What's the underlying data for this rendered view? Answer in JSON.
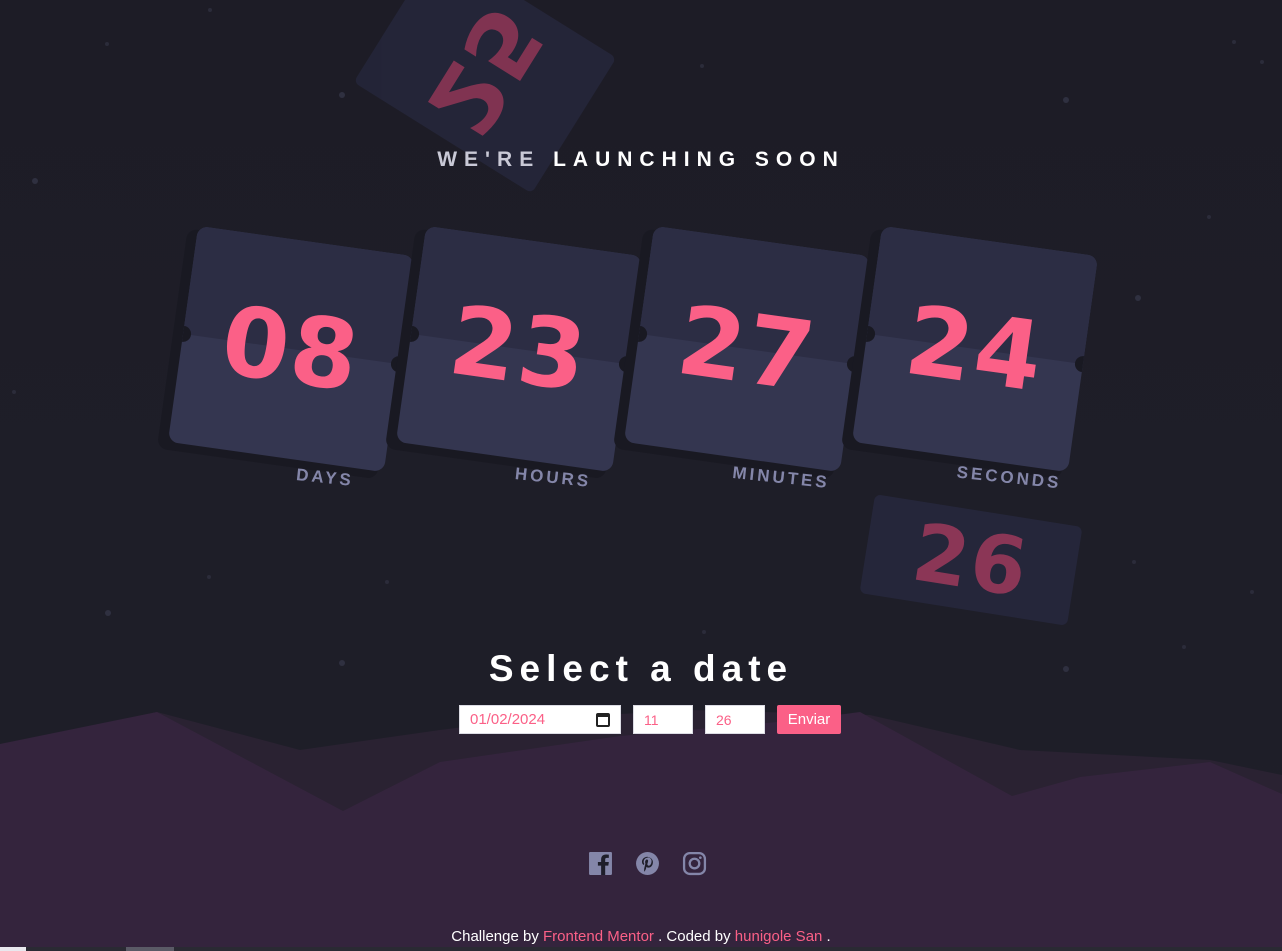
{
  "header": {
    "title_dim": "WE'RE",
    "title_main": "LAUNCHING SOON"
  },
  "countdown": {
    "units": [
      {
        "value": "08",
        "label": "DAYS"
      },
      {
        "value": "23",
        "label": "HOURS"
      },
      {
        "value": "27",
        "label": "MINUTES"
      },
      {
        "value": "24",
        "label": "SECONDS"
      }
    ],
    "floating_top": "25",
    "floating_bottom": "26"
  },
  "form": {
    "title": "Select a date",
    "date_value": "01/02/2024",
    "hour_value": "11",
    "minute_value": "26",
    "submit_label": "Enviar"
  },
  "social": {
    "icons": [
      "facebook-icon",
      "pinterest-icon",
      "instagram-icon"
    ]
  },
  "footer": {
    "challenge_prefix": "Challenge by",
    "challenge_link": "Frontend Mentor",
    "coded_prefix": ". Coded by",
    "coded_link": "hunigole San",
    "suffix": "."
  },
  "colors": {
    "accent": "#fb6087",
    "background": "#1e1e2a",
    "card": "#343650",
    "label": "#8486a9",
    "hills": "#34243d"
  }
}
